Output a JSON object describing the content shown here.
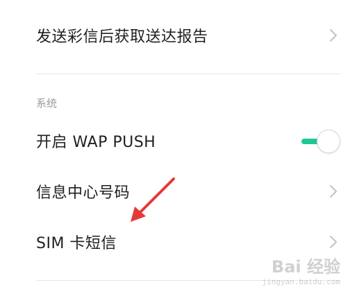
{
  "rows": {
    "mms_delivery_report": {
      "label": "发送彩信后获取送达报告"
    },
    "wap_push": {
      "label": "开启 WAP PUSH",
      "enabled": true
    },
    "message_center_number": {
      "label": "信息中心号码"
    },
    "sim_card_sms": {
      "label": "SIM 卡短信"
    }
  },
  "section": {
    "system_header": "系统"
  },
  "colors": {
    "toggle_on": "#1ec894",
    "annotation_arrow": "#e53935",
    "chevron": "#c2c2c2"
  },
  "icons": {
    "chevron": "chevron-right-icon",
    "arrow": "red-annotation-arrow"
  },
  "watermark": {
    "logo": "Bai 经验",
    "url": "jingyan.baidu.com"
  }
}
